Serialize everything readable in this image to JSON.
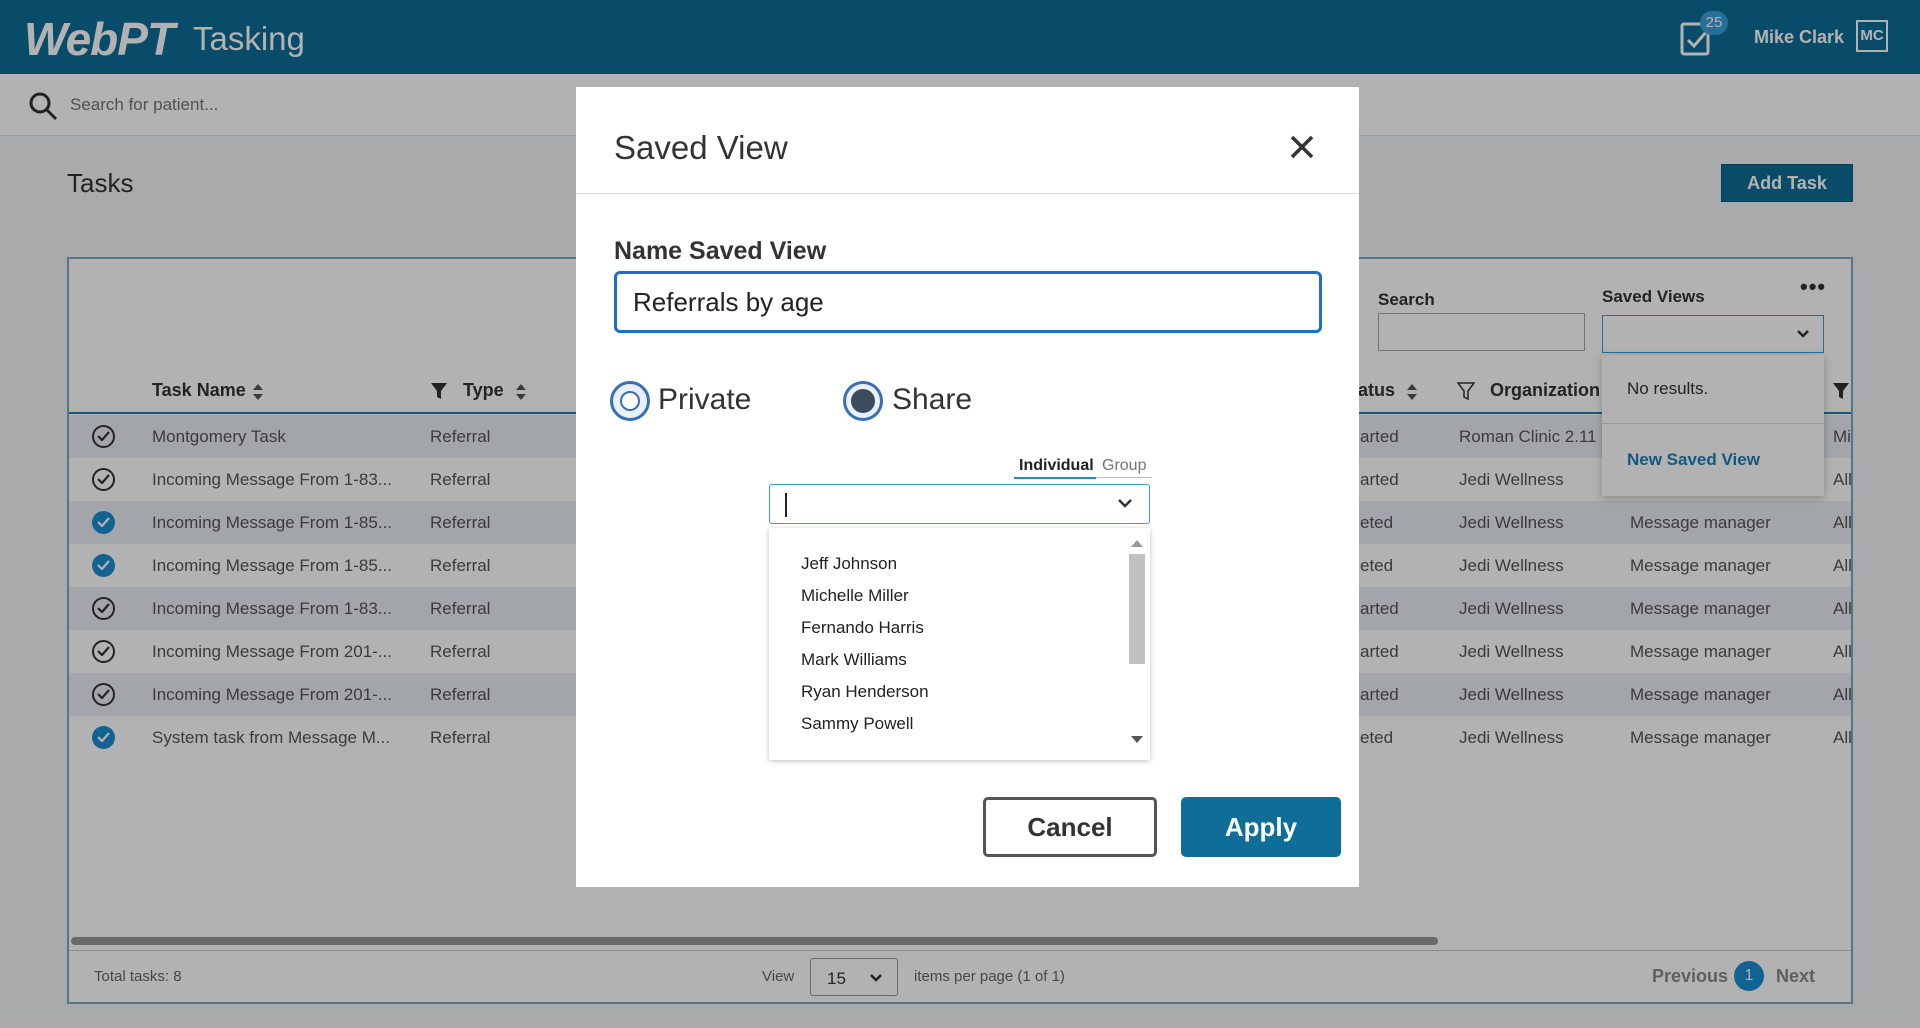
{
  "header": {
    "logo": "WebPT",
    "app_name": "Tasking",
    "task_count": "25",
    "user_name": "Mike Clark",
    "user_initials": "MC"
  },
  "search": {
    "placeholder": "Search for patient..."
  },
  "page": {
    "title": "Tasks",
    "add_task_label": "Add Task"
  },
  "filters": {
    "search_label": "Search",
    "saved_views_label": "Saved Views",
    "saved_views_no_results": "No results.",
    "new_saved_view_label": "New Saved View",
    "more": "•••"
  },
  "table": {
    "columns": [
      "Task Name",
      "Type",
      "atus",
      "Organization"
    ],
    "rows": [
      {
        "status": "outline",
        "name": "Montgomery Task",
        "type": "Referral",
        "state": "arted",
        "org": "Roman Clinic 2.11",
        "assignee": "",
        "extra": "Mi"
      },
      {
        "status": "outline",
        "name": "Incoming Message From 1-83...",
        "type": "Referral",
        "state": "arted",
        "org": "Jedi Wellness",
        "assignee": "",
        "extra": "All"
      },
      {
        "status": "filled",
        "name": "Incoming Message From 1-85...",
        "type": "Referral",
        "state": "eted",
        "org": "Jedi Wellness",
        "assignee": "Message manager",
        "extra": "All"
      },
      {
        "status": "filled",
        "name": "Incoming Message From 1-85...",
        "type": "Referral",
        "state": "eted",
        "org": "Jedi Wellness",
        "assignee": "Message manager",
        "extra": "All"
      },
      {
        "status": "outline",
        "name": "Incoming Message From 1-83...",
        "type": "Referral",
        "state": "arted",
        "org": "Jedi Wellness",
        "assignee": "Message manager",
        "extra": "All"
      },
      {
        "status": "outline",
        "name": "Incoming Message From 201-...",
        "type": "Referral",
        "state": "arted",
        "org": "Jedi Wellness",
        "assignee": "Message manager",
        "extra": "All"
      },
      {
        "status": "outline",
        "name": "Incoming Message From 201-...",
        "type": "Referral",
        "state": "arted",
        "org": "Jedi Wellness",
        "assignee": "Message manager",
        "extra": "All"
      },
      {
        "status": "filled",
        "name": "System task from Message M...",
        "type": "Referral",
        "state": "eted",
        "org": "Jedi Wellness",
        "assignee": "Message manager",
        "extra": "All"
      }
    ]
  },
  "footer": {
    "total": "Total tasks: 8",
    "view_label": "View",
    "per_page": "15",
    "per_page_suffix": "items per page (1 of 1)",
    "prev": "Previous",
    "page": "1",
    "next": "Next"
  },
  "modal": {
    "title": "Saved View",
    "name_label": "Name Saved View",
    "name_value": "Referrals by age",
    "private_label": "Private",
    "share_label": "Share",
    "selected_visibility": "Share",
    "tab_individual": "Individual",
    "tab_group": "Group",
    "people": [
      "Jeff Johnson",
      "Michelle Miller",
      "Fernando Harris",
      "Mark Williams",
      "Ryan Henderson",
      "Sammy Powell"
    ],
    "cancel_label": "Cancel",
    "apply_label": "Apply"
  },
  "colors": {
    "brand": "#0e6e97",
    "accent": "#1b8fd0",
    "focus": "#1f6ec7"
  }
}
